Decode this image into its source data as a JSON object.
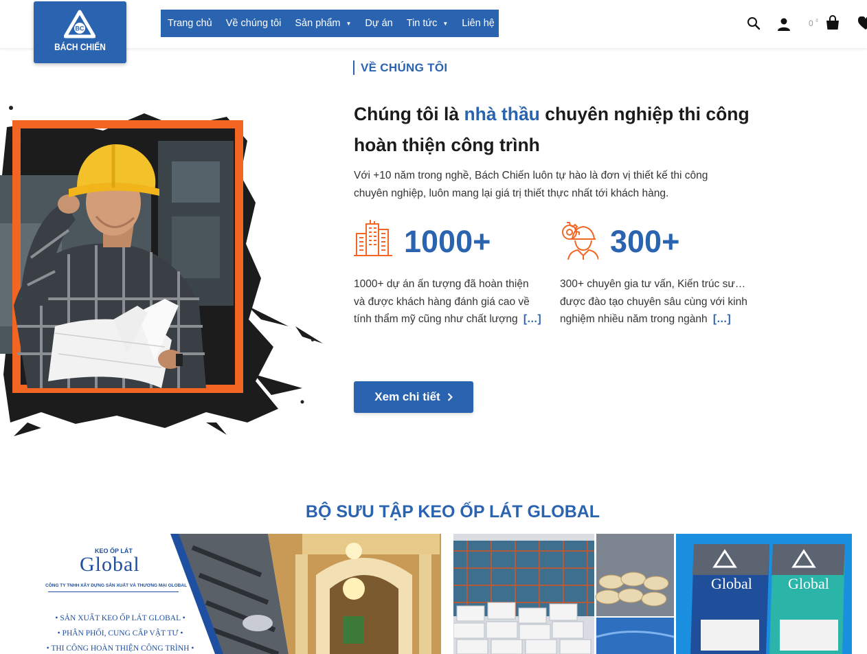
{
  "brand": {
    "name": "BÁCH CHIẾN",
    "monogram": "BC",
    "color": "#2a63b0",
    "accent": "#f26522"
  },
  "nav": {
    "items": [
      {
        "label": "Trang chủ",
        "dropdown": false
      },
      {
        "label": "Về chúng tôi",
        "dropdown": false
      },
      {
        "label": "Sản phẩm",
        "dropdown": true
      },
      {
        "label": "Dự án",
        "dropdown": false
      },
      {
        "label": "Tin tức",
        "dropdown": true
      },
      {
        "label": "Liên hệ",
        "dropdown": false
      }
    ],
    "caret": "▼"
  },
  "header_icons": {
    "search": "search-icon",
    "account": "user-icon",
    "cart_amount": "0",
    "currency": "₫",
    "cart": "shopping-bag-icon",
    "wishlist": "heart-icon"
  },
  "about": {
    "eyebrow": "VỀ CHÚNG TÔI",
    "headline_before": "Chúng tôi là ",
    "headline_highlight": "nhà thầu",
    "headline_after": " chuyên nghiệp thi công hoàn thiện công trình",
    "intro": "Với +10 năm trong nghề, Bách Chiến luôn tự hào là đơn vị thiết kế thi công chuyên nghiệp, luôn mang lại giá trị thiết thực nhất tới khách hàng.",
    "stats": [
      {
        "icon": "buildings-icon",
        "number": "1000+",
        "desc": "1000+ dự án ấn tượng đã hoàn thiện và được khách hàng đánh giá cao về tính thẩm mỹ cũng như chất lượng",
        "more": "[…]"
      },
      {
        "icon": "engineer-gear-icon",
        "number": "300+",
        "desc": "300+ chuyên gia tư vấn, Kiến trúc sư… được đào tạo chuyên sâu cùng với kinh nghiệm nhiều năm trong ngành",
        "more": "[…]"
      }
    ],
    "cta": "Xem chi tiết",
    "cta_icon": "chevron-right-icon"
  },
  "collection": {
    "title": "BỘ SƯU TẬP KEO ỐP LÁT GLOBAL",
    "banner1": {
      "kicker": "KEO ỐP LÁT",
      "brand": "Global",
      "company": "CÔNG TY TNHH XÂY DỰNG SẢN XUẤT VÀ THƯƠNG MẠI GLOBAL",
      "bullets": [
        "SẢN XUẤT KEO ỐP LÁT GLOBAL",
        "PHÂN PHỐI, CUNG CẤP VẬT TƯ",
        "THI CÔNG HOÀN THIỆN CÔNG TRÌNH"
      ]
    },
    "banner2": {
      "bag_brand": "Global"
    }
  }
}
